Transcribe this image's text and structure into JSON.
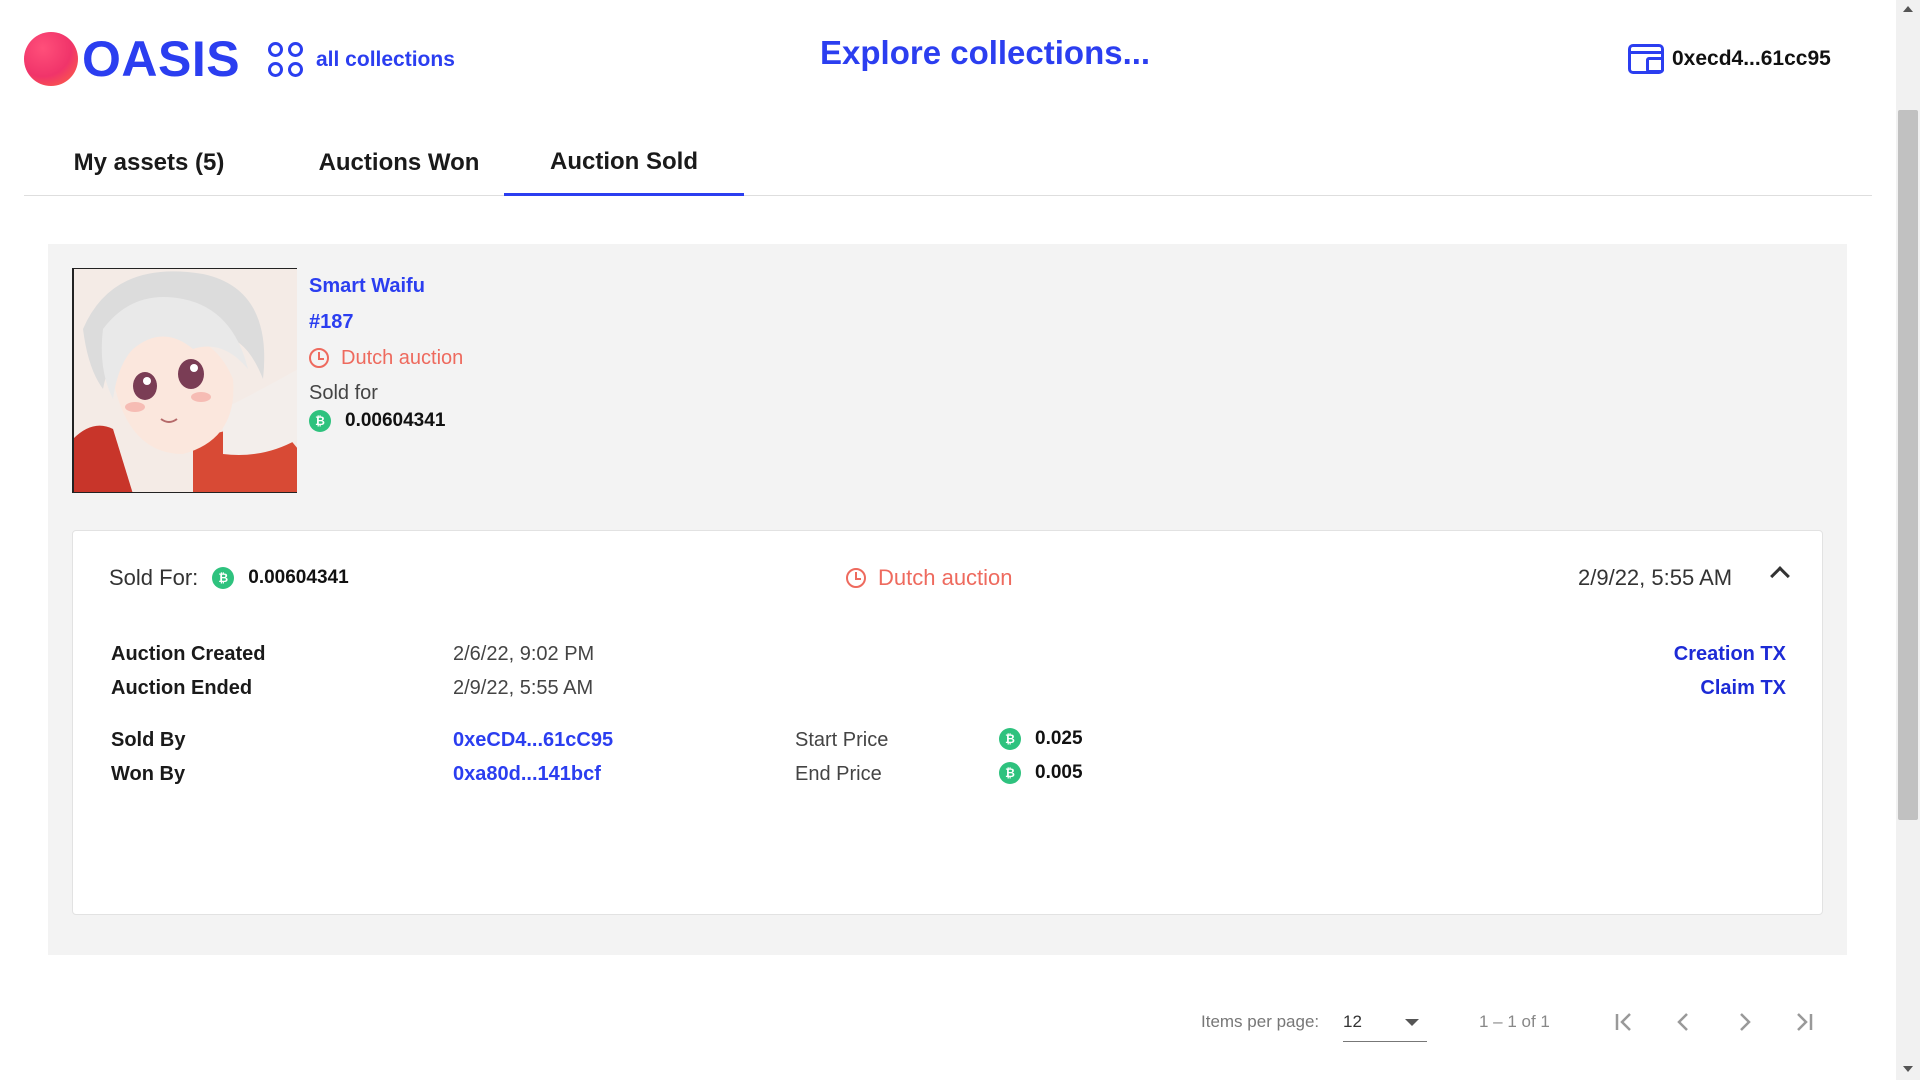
{
  "header": {
    "logo_text": "OASIS",
    "all_collections_label": "all collections",
    "explore_title": "Explore collections...",
    "wallet_address": "0xecd4...61cc95"
  },
  "tabs": [
    {
      "label": "My assets (5)",
      "active": false
    },
    {
      "label": "Auctions Won",
      "active": false
    },
    {
      "label": "Auction Sold",
      "active": true
    }
  ],
  "item": {
    "name": "Smart Waifu",
    "number": "#187",
    "auction_type": "Dutch auction",
    "sold_for_label": "Sold for",
    "sold_for_value": "0.00604341",
    "currency_icon": "coin-icon"
  },
  "details": {
    "sold_for_label": "Sold For:",
    "sold_for_value": "0.00604341",
    "auction_type": "Dutch auction",
    "date": "2/9/22, 5:55 AM",
    "auction_created_label": "Auction Created",
    "auction_created_value": "2/6/22, 9:02 PM",
    "auction_ended_label": "Auction Ended",
    "auction_ended_value": "2/9/22, 5:55 AM",
    "creation_tx_label": "Creation TX",
    "claim_tx_label": "Claim TX",
    "sold_by_label": "Sold By",
    "sold_by_value": "0xeCD4...61cC95",
    "won_by_label": "Won By",
    "won_by_value": "0xa80d...141bcf",
    "start_price_label": "Start Price",
    "start_price_value": "0.025",
    "end_price_label": "End Price",
    "end_price_value": "0.005"
  },
  "pagination": {
    "items_per_page_label": "Items per page:",
    "items_per_page_value": "12",
    "range_label": "1 – 1 of 1"
  },
  "colors": {
    "accent": "#2b3ef0",
    "auction": "#ee6a5e",
    "coin": "#2ec27e",
    "card_bg": "#f3f3f3"
  }
}
